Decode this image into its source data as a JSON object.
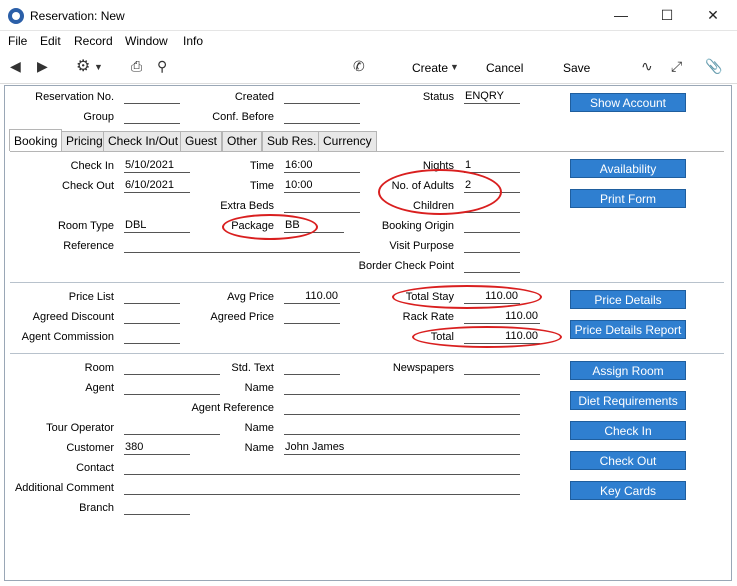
{
  "window": {
    "title": "Reservation: New"
  },
  "menu": [
    "File",
    "Edit",
    "Record",
    "Window",
    "Info"
  ],
  "toolbar": {
    "create": "Create",
    "cancel": "Cancel",
    "save": "Save"
  },
  "header": {
    "reservation_no_label": "Reservation No.",
    "reservation_no": "",
    "created_label": "Created",
    "created": "",
    "status_label": "Status",
    "status": "ENQRY",
    "group_label": "Group",
    "group": "",
    "conf_before_label": "Conf. Before",
    "conf_before": "",
    "show_account": "Show Account"
  },
  "tabs": [
    "Booking",
    "Pricing",
    "Check In/Out",
    "Guest",
    "Other",
    "Sub Res.",
    "Currency"
  ],
  "booking": {
    "check_in_label": "Check In",
    "check_in": "5/10/2021",
    "time1_label": "Time",
    "time1": "16:00",
    "nights_label": "Nights",
    "nights": "1",
    "check_out_label": "Check Out",
    "check_out": "6/10/2021",
    "time2_label": "Time",
    "time2": "10:00",
    "adults_label": "No. of Adults",
    "adults": "2",
    "extra_beds_label": "Extra Beds",
    "extra_beds": "",
    "children_label": "Children",
    "children": "",
    "room_type_label": "Room Type",
    "room_type": "DBL",
    "package_label": "Package",
    "package": "BB",
    "booking_origin_label": "Booking Origin",
    "booking_origin": "",
    "reference_label": "Reference",
    "reference": "",
    "visit_purpose_label": "Visit Purpose",
    "visit_purpose": "",
    "border_check_label": "Border Check Point",
    "border_check": "",
    "availability": "Availability",
    "print_form": "Print Form"
  },
  "pricing": {
    "price_list_label": "Price List",
    "price_list": "",
    "avg_price_label": "Avg Price",
    "avg_price": "110.00",
    "total_stay_label": "Total Stay",
    "total_stay": "110.00",
    "agreed_discount_label": "Agreed Discount",
    "agreed_discount": "",
    "agreed_price_label": "Agreed Price",
    "agreed_price": "",
    "rack_rate_label": "Rack Rate",
    "rack_rate": "110.00",
    "agent_commission_label": "Agent Commission",
    "agent_commission": "",
    "total_label": "Total",
    "total": "110.00",
    "price_details": "Price Details",
    "price_details_report": "Price Details Report"
  },
  "guest": {
    "room_label": "Room",
    "room": "",
    "std_text_label": "Std. Text",
    "std_text": "",
    "newspapers_label": "Newspapers",
    "newspapers": "",
    "agent_label": "Agent",
    "agent": "",
    "agent_name_label": "Name",
    "agent_name": "",
    "agent_reference_label": "Agent Reference",
    "agent_reference": "",
    "tour_operator_label": "Tour Operator",
    "tour_operator": "",
    "tour_name_label": "Name",
    "tour_name": "",
    "customer_label": "Customer",
    "customer": "380",
    "customer_name_label": "Name",
    "customer_name": "John James",
    "contact_label": "Contact",
    "contact": "",
    "additional_comment_label": "Additional Comment",
    "additional_comment": "",
    "branch_label": "Branch",
    "branch": "",
    "assign_room": "Assign Room",
    "diet_requirements": "Diet Requirements",
    "check_in_btn": "Check In",
    "check_out_btn": "Check Out",
    "key_cards": "Key Cards"
  },
  "colors": {
    "button": "#2f7fd0",
    "annotation": "#d91f1f"
  }
}
